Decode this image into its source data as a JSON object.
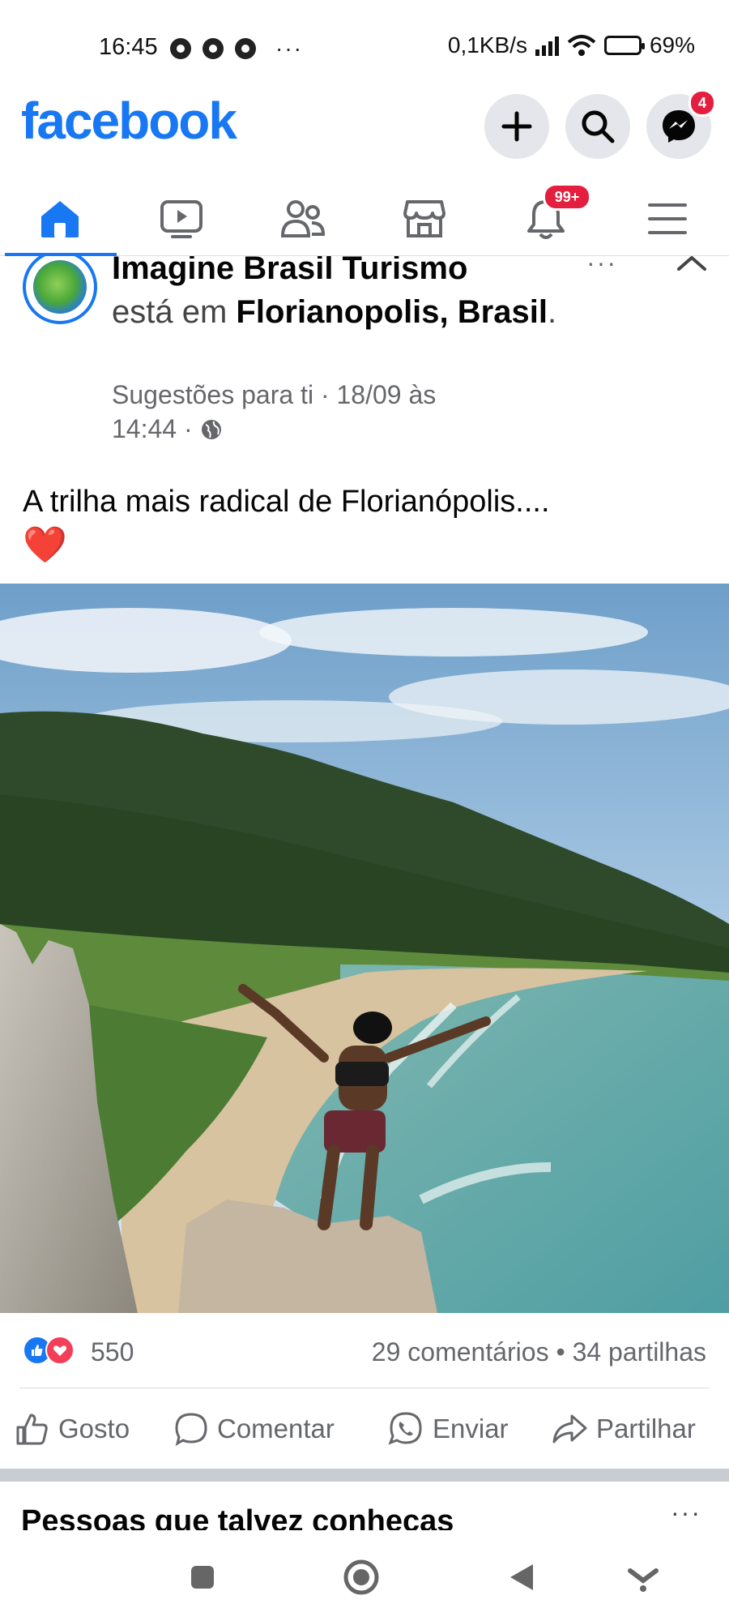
{
  "status_bar": {
    "time": "16:45",
    "dots": "···",
    "network_speed": "0,1KB/s",
    "battery": "69%",
    "battery_level": 0.69
  },
  "header": {
    "logo": "facebook",
    "messenger_badge": "4",
    "icons": [
      "plus-icon",
      "search-icon",
      "messenger-icon"
    ]
  },
  "nav": {
    "tabs": [
      {
        "name": "home",
        "icon": "home-icon",
        "active": true
      },
      {
        "name": "watch",
        "icon": "video-icon"
      },
      {
        "name": "friends",
        "icon": "friends-icon"
      },
      {
        "name": "marketplace",
        "icon": "store-icon"
      },
      {
        "name": "notifications",
        "icon": "bell-icon",
        "badge": "99+"
      },
      {
        "name": "menu",
        "icon": "menu-icon"
      }
    ]
  },
  "post": {
    "author": "Imagine Brasil Turismo",
    "is_at": "está em",
    "location": "Florianopolis, Brasil",
    "location_period": ".",
    "meta_line1": "Sugestões para ti · 18/09 às",
    "meta_line2": "14:44 ·",
    "more": "···",
    "text": "A trilha mais radical de Florianópolis....",
    "emoji": "❤️",
    "reaction_count": "550",
    "comments": "29 comentários",
    "shares": "34 partilhas",
    "separator": "•"
  },
  "actions": {
    "like": "Gosto",
    "comment": "Comentar",
    "send": "Enviar",
    "share": "Partilhar"
  },
  "next_section": {
    "title": "Pessoas que talvez conheças",
    "more": "···"
  },
  "colors": {
    "brand": "#1877f2",
    "badge": "#e41e3f",
    "muted": "#65676b"
  }
}
